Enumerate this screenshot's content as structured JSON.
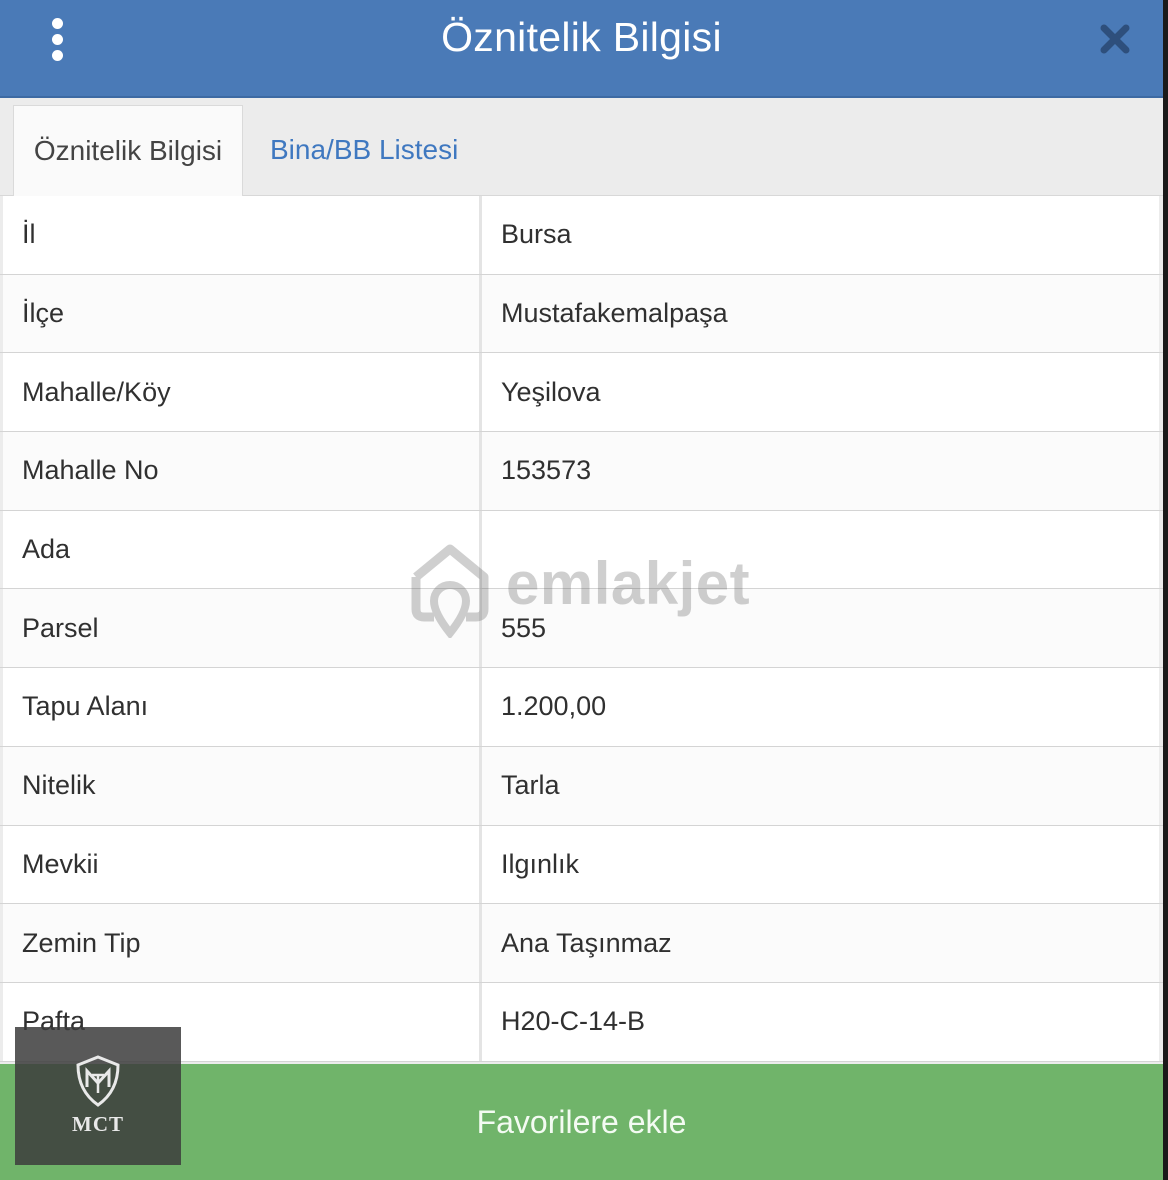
{
  "header": {
    "title": "Öznitelik Bilgisi",
    "menu_icon": "more-vertical-icon",
    "close_icon": "close-icon"
  },
  "tabs": [
    {
      "label": "Öznitelik Bilgisi",
      "active": true
    },
    {
      "label": "Bina/BB Listesi",
      "active": false
    }
  ],
  "rows": [
    {
      "key": "İl",
      "value": "Bursa"
    },
    {
      "key": "İlçe",
      "value": "Mustafakemalpaşa"
    },
    {
      "key": "Mahalle/Köy",
      "value": "Yeşilova"
    },
    {
      "key": "Mahalle No",
      "value": "153573"
    },
    {
      "key": "Ada",
      "value": ""
    },
    {
      "key": "Parsel",
      "value": "555"
    },
    {
      "key": "Tapu Alanı",
      "value": "1.200,00"
    },
    {
      "key": "Nitelik",
      "value": "Tarla"
    },
    {
      "key": "Mevkii",
      "value": "Ilgınlık"
    },
    {
      "key": "Zemin Tip",
      "value": "Ana Taşınmaz"
    },
    {
      "key": "Pafta",
      "value": "H20-C-14-B"
    }
  ],
  "footer": {
    "favorite_label": "Favorilere ekle"
  },
  "watermark": {
    "text": "emlakjet"
  },
  "logo": {
    "text": "MCT"
  },
  "colors": {
    "header_bg": "#4a7ab7",
    "tab_link": "#3f78c0",
    "footer_bg": "#70b46a"
  }
}
